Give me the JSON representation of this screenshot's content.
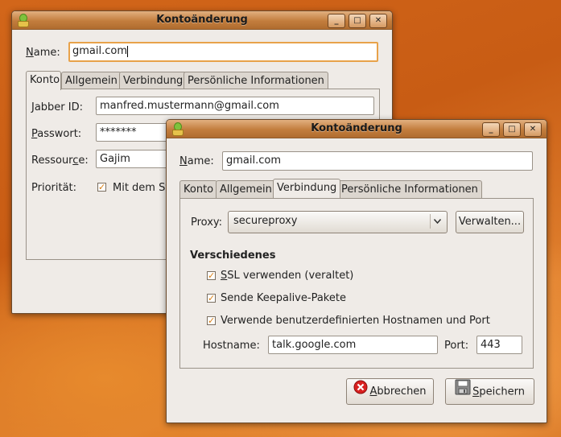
{
  "back_window": {
    "title": "Kontoänderung",
    "name_label_u": "N",
    "name_label_rest": "ame:",
    "name_value": "gmail.com",
    "tabs": [
      "Konto",
      "Allgemein",
      "Verbindung",
      "Persönliche Informationen"
    ],
    "jabber_label": "Jabber ID:",
    "jabber_value": "manfred.mustermann@gmail.com",
    "password_label_u": "P",
    "password_label_rest": "asswort:",
    "password_value": "*******",
    "resource_label_a": "Ressour",
    "resource_label_u": "c",
    "resource_label_b": "e:",
    "resource_value": "Gajim",
    "priority_label": "Priorität:",
    "priority_check_label": "Mit dem St"
  },
  "front_window": {
    "title": "Kontoänderung",
    "name_label_u": "N",
    "name_label_rest": "ame:",
    "name_value": "gmail.com",
    "tabs": [
      "Konto",
      "Allgemein",
      "Verbindung",
      "Persönliche Informationen"
    ],
    "proxy_label": "Proxy:",
    "proxy_value": "secureproxy",
    "manage_button": "Verwalten...",
    "section_title": "Verschiedenes",
    "checkboxes": [
      {
        "u": "S",
        "rest": "SL verwenden (veraltet)",
        "checked": true
      },
      {
        "u": "",
        "rest": "Sende Keepalive-Pakete",
        "checked": true
      },
      {
        "u": "",
        "rest": "Verwende benutzerdefinierten Hostnamen und Port",
        "checked": true
      }
    ],
    "hostname_label": "Hostname:",
    "hostname_value": "talk.google.com",
    "port_label": "Port:",
    "port_value": "443",
    "cancel_u": "A",
    "cancel_rest": "bbrechen",
    "save_u": "S",
    "save_rest": "peichern"
  },
  "icons": {
    "app": "gajim-app-icon",
    "minimize": "minimize-icon",
    "maximize": "maximize-icon",
    "close": "close-icon",
    "cancel": "cancel-icon",
    "save": "floppy-disk-icon",
    "dropdown": "chevron-down-icon"
  },
  "colors": {
    "accent_orange": "#e8a24a",
    "titlebar": "#c27d3d",
    "window_bg": "#efebe7",
    "check_mark": "#d97d12"
  }
}
